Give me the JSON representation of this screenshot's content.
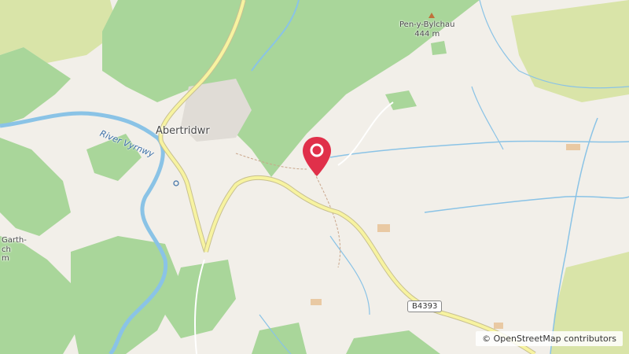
{
  "map": {
    "places": {
      "town": "Abertridwr",
      "peak_name": "Pen-y-Bylchau",
      "peak_elevation": "444 m",
      "partial_label_line1": "Garth-",
      "partial_label_line2": "ch",
      "partial_label_line3": "m"
    },
    "river_label": "River Vyrnwy",
    "road_label": "B4393",
    "attribution": "© OpenStreetMap contributors",
    "marker": {
      "icon": "location-pin-icon",
      "color": "#e0304a"
    },
    "colors": {
      "land": "#f2efe9",
      "forest": "#9fd08c",
      "scrub": "#d9e4a8",
      "water": "#8ac3e6",
      "main_road": "#f7f3a0"
    }
  }
}
